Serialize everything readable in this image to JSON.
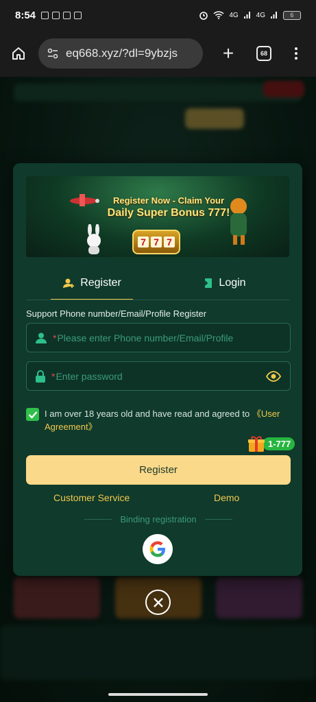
{
  "status_bar": {
    "time": "8:54",
    "network_1": "4G",
    "network_2": "4G",
    "battery": "6"
  },
  "browser": {
    "url": "eq668.xyz/?dl=9ybzjs",
    "tab_count": "68"
  },
  "banner": {
    "line1": "Register Now - Claim Your",
    "line2": "Daily Super Bonus 777!",
    "slot_digits": [
      "7",
      "7",
      "7"
    ]
  },
  "tabs": [
    {
      "label": "Register",
      "active": true
    },
    {
      "label": "Login",
      "active": false
    }
  ],
  "form": {
    "support_label": "Support Phone number/Email/Profile Register",
    "phone_placeholder": "Please enter Phone number/Email/Profile",
    "password_placeholder": "Enter password",
    "required_mark": "*",
    "agree_text": "I am over 18 years old and have read and agreed to",
    "agree_link": "《User Agreement》",
    "agree_checked": true,
    "bonus_badge": "1-777",
    "register_button": "Register"
  },
  "links": {
    "customer_service": "Customer Service",
    "demo": "Demo"
  },
  "binding_label": "Binding registration",
  "colors": {
    "modal_bg": "#0f3a2c",
    "accent_gold": "#f2c94c",
    "button_bg": "#fbd98a",
    "placeholder": "#3c9b78",
    "check_green": "#2fbf4a"
  }
}
